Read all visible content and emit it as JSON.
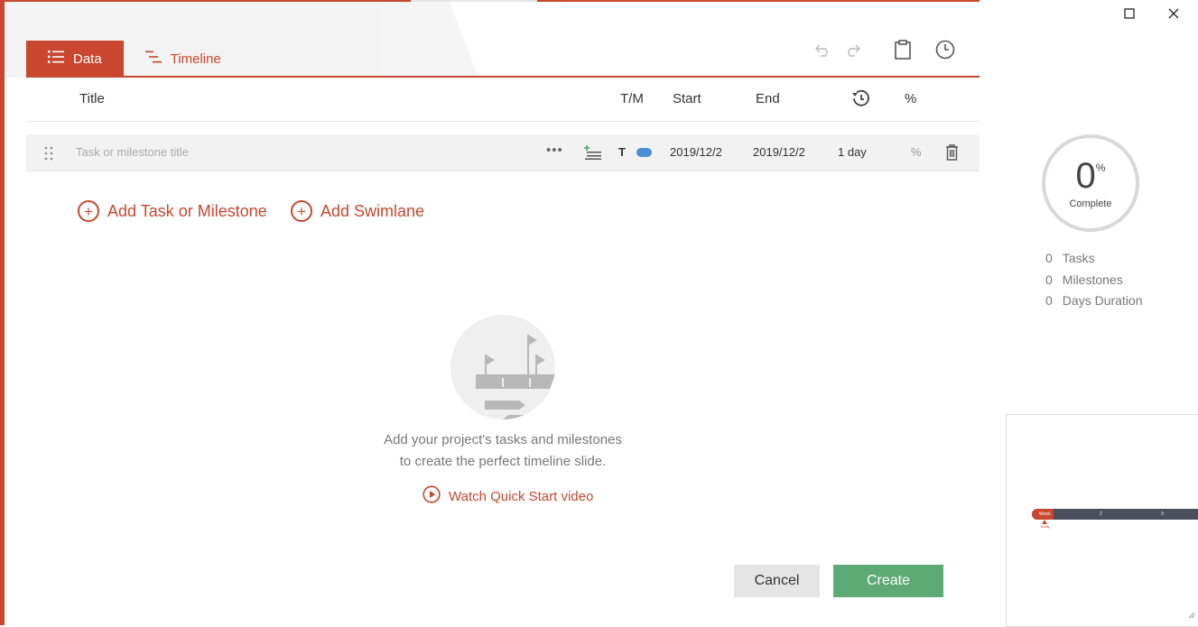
{
  "window": {
    "maximize_icon": "maximize-icon",
    "close_icon": "close-icon"
  },
  "tabs": [
    {
      "label": "Data",
      "icon": "list-icon",
      "active": true
    },
    {
      "label": "Timeline",
      "icon": "timeline-icon",
      "active": false
    }
  ],
  "toolbar": {
    "undo_icon": "undo-icon",
    "redo_icon": "redo-icon",
    "clipboard_icon": "clipboard-icon",
    "clock_icon": "clock-icon"
  },
  "columns": {
    "title": "Title",
    "type": "T/M",
    "start": "Start",
    "end": "End",
    "duration_icon": "history-icon",
    "percent": "%"
  },
  "task_row": {
    "title_placeholder": "Task or milestone title",
    "more": "•••",
    "type": "T",
    "start": "2019/12/2",
    "end": "2019/12/2",
    "duration": "1 day",
    "percent": "%"
  },
  "actions": {
    "add_task": "Add Task or Milestone",
    "add_swimlane": "Add Swimlane"
  },
  "empty_state": {
    "line1": "Add your project's tasks and milestones",
    "line2": "to create the perfect timeline slide.",
    "video_link": "Watch Quick Start video"
  },
  "buttons": {
    "cancel": "Cancel",
    "create": "Create"
  },
  "progress": {
    "value": "0",
    "symbol": "%",
    "label": "Complete"
  },
  "stats": [
    {
      "count": "0",
      "label": "Tasks"
    },
    {
      "count": "0",
      "label": "Milestones"
    },
    {
      "count": "0",
      "label": "Days Duration"
    }
  ],
  "preview": {
    "week1": "Week 1",
    "tick2": "2",
    "tick3": "3",
    "today": "Today"
  },
  "colors": {
    "accent": "#c8472e",
    "create": "#5daa74",
    "task_pill": "#4a8fd6"
  }
}
